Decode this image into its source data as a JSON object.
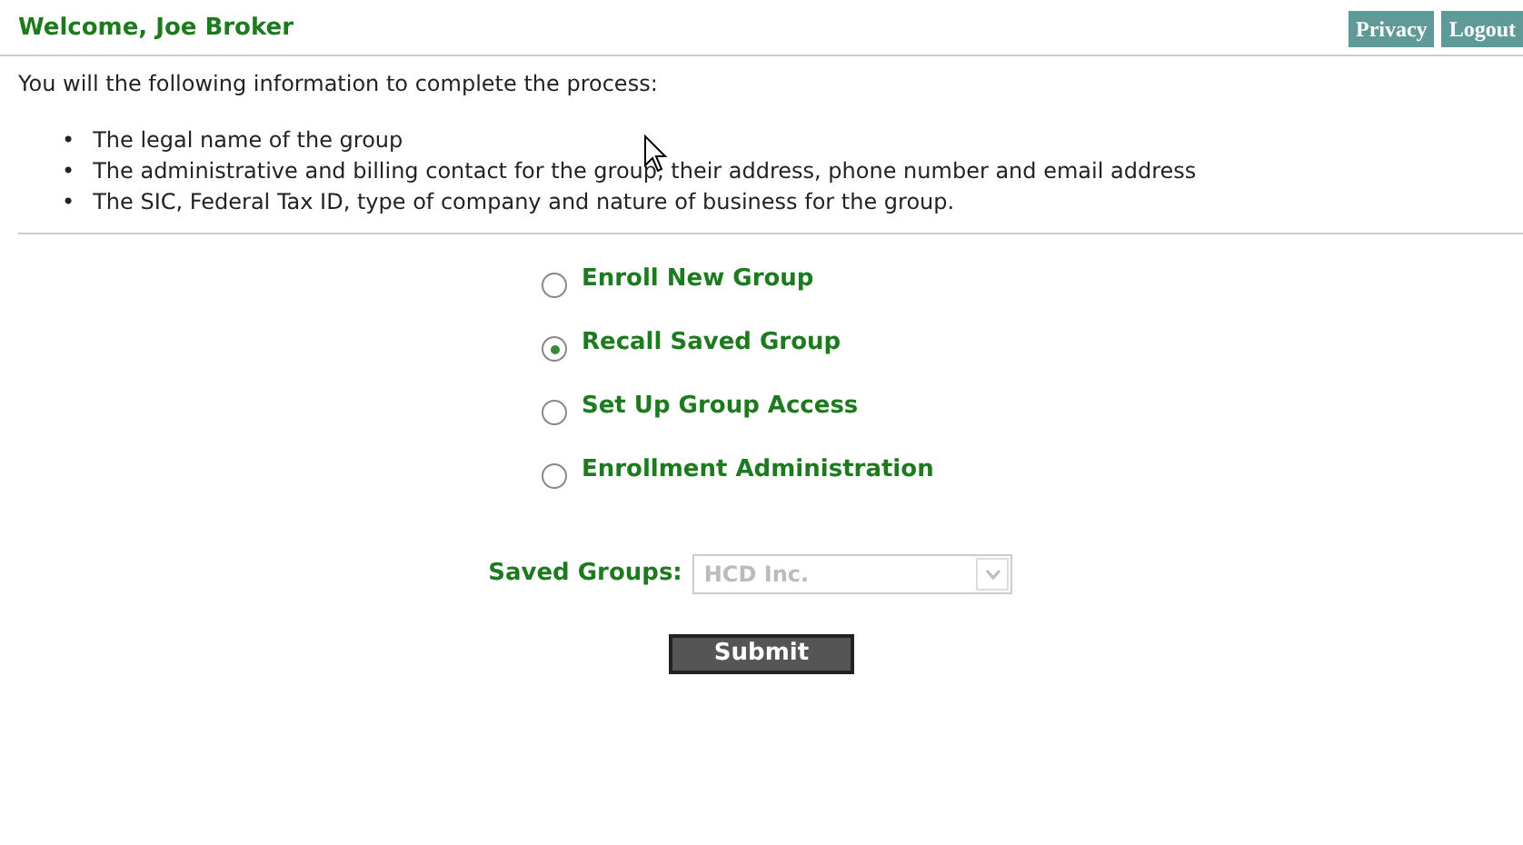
{
  "header": {
    "title": "Welcome, Joe Broker",
    "links": [
      "Privacy",
      "Logout"
    ]
  },
  "intro": "You will the following information to complete the process:",
  "requirements": [
    {
      "bullet": "•",
      "text": "The legal name of the group"
    },
    {
      "bullet": "•",
      "text": "The administrative and billing contact for the group, their address, phone number and email address"
    },
    {
      "bullet": "•",
      "text": "The SIC, Federal Tax ID, type of company and nature of business for the group."
    }
  ],
  "options": [
    {
      "label": "Enroll New Group",
      "selected": false
    },
    {
      "label": "Recall Saved Group",
      "selected": true
    },
    {
      "label": "Set Up Group Access",
      "selected": false
    },
    {
      "label": "Enrollment Administration",
      "selected": false
    }
  ],
  "saved_groups": {
    "label": "Saved Groups:",
    "value": "HCD Inc.",
    "disabled": true
  },
  "submit": "Submit"
}
